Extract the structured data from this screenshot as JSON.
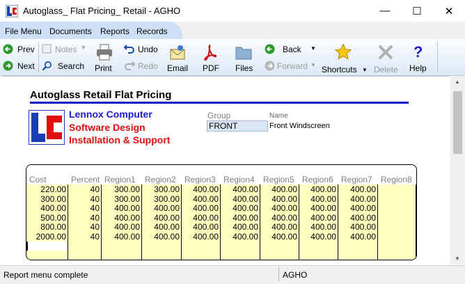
{
  "window": {
    "title": "Autoglass_ Flat Pricing_ Retail - AGHO",
    "minimize": "—",
    "maximize": "☐",
    "close": "✕"
  },
  "menu": {
    "items": [
      "File Menu",
      "Documents",
      "Reports",
      "Records"
    ]
  },
  "toolbar": {
    "prev": "Prev",
    "next": "Next",
    "notes": "Notes",
    "search": "Search",
    "print": "Print",
    "undo": "Undo",
    "redo": "Redo",
    "email": "Email",
    "pdf": "PDF",
    "files": "Files",
    "back": "Back",
    "forward": "Forward",
    "shortcuts": "Shortcuts",
    "delete": "Delete",
    "help": "Help"
  },
  "report": {
    "title": "Autoglass Retail Flat Pricing",
    "company": {
      "line1": "Lennox Computer",
      "line2": "Software Design",
      "line3": "Installation & Support"
    },
    "group_label": "Group",
    "group_value": "FRONT",
    "name_label": "Name",
    "name_value": "Front Windscreen"
  },
  "table": {
    "headers": [
      "Cost",
      "Percent",
      "Region1",
      "Region2",
      "Region3",
      "Region4",
      "Region5",
      "Region6",
      "Region7",
      "Region8"
    ],
    "rows": [
      [
        "220.00",
        "40",
        "300.00",
        "300.00",
        "400.00",
        "400.00",
        "400.00",
        "400.00",
        "400.00",
        ""
      ],
      [
        "300.00",
        "40",
        "300.00",
        "300.00",
        "400.00",
        "400.00",
        "400.00",
        "400.00",
        "400.00",
        ""
      ],
      [
        "400.00",
        "40",
        "400.00",
        "400.00",
        "400.00",
        "400.00",
        "400.00",
        "400.00",
        "400.00",
        ""
      ],
      [
        "500.00",
        "40",
        "400.00",
        "400.00",
        "400.00",
        "400.00",
        "400.00",
        "400.00",
        "400.00",
        ""
      ],
      [
        "800.00",
        "40",
        "400.00",
        "400.00",
        "400.00",
        "400.00",
        "400.00",
        "400.00",
        "400.00",
        ""
      ],
      [
        "2000.00",
        "40",
        "400.00",
        "400.00",
        "400.00",
        "400.00",
        "400.00",
        "400.00",
        "400.00",
        ""
      ]
    ]
  },
  "status": {
    "message": "Report menu complete",
    "user": "AGHO"
  }
}
